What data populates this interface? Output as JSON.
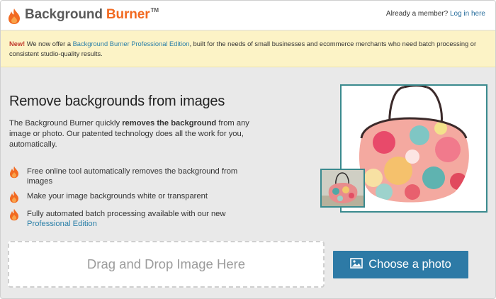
{
  "header": {
    "brand_word1": "Background",
    "brand_word2": "Burner",
    "brand_tm": "TM",
    "member_prompt": "Already a member?",
    "login_link": "Log in here"
  },
  "notice": {
    "new_label": "New!",
    "text_before": " We now offer a ",
    "link": "Background Burner Professional Edition",
    "text_after": ", built for the needs of small businesses and ecommerce merchants who need batch processing or consistent studio-quality results."
  },
  "main": {
    "headline": "Remove backgrounds from images",
    "intro_before": "The Background Burner quickly ",
    "intro_bold": "removes the background",
    "intro_after": " from any image or photo. Our patented technology does all the work for you, automatically.",
    "features": [
      {
        "text": "Free online tool automatically removes the background from images"
      },
      {
        "text": "Make your image backgrounds white or transparent"
      },
      {
        "text": "Fully automated batch processing available with our new",
        "link": "Professional Edition"
      }
    ]
  },
  "upload": {
    "dropzone_label": "Drag and Drop Image Here",
    "choose_button": "Choose a photo"
  },
  "colors": {
    "brand_orange": "#f26a21",
    "notice_bg": "#fcf3c6",
    "button_blue": "#2d7aa6",
    "link_blue": "#2a7fa8",
    "image_border": "#3a8a8e"
  },
  "icons": {
    "logo": "flame-logo-icon",
    "bullet": "flame-bullet-icon",
    "button": "image-icon"
  }
}
